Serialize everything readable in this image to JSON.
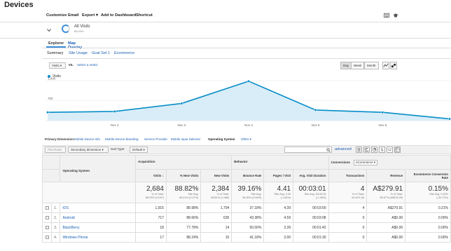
{
  "header": {
    "title": "Devices"
  },
  "toolbar": {
    "customize": "Customize",
    "email": "Email",
    "export": "Export ▾",
    "add_to_dashboard": "Add to Dashboard",
    "shortcut": "Shortcut"
  },
  "segment": {
    "label": "All Visits",
    "sub": "88.09%"
  },
  "views": {
    "explorer": "Explorer",
    "map_overlay": "Map Overlay"
  },
  "subnav": {
    "summary": "Summary",
    "site_usage": "Site Usage",
    "goal_set": "Goal Set 1",
    "ecommerce": "Ecommerce"
  },
  "chart_controls": {
    "metric": "Visits ▾",
    "vs": "vs.",
    "select_metric": "Select a metric",
    "day": "Day",
    "week": "Week",
    "month": "Month"
  },
  "chart_data": {
    "type": "line",
    "x": [
      "Nov 1",
      "Nov 2",
      "Nov 3",
      "Nov 4",
      "Nov 5",
      "Nov 6",
      "Nov 7"
    ],
    "series": [
      {
        "name": "Visits",
        "values": [
          290,
          320,
          600,
          1380,
          370,
          290,
          60
        ]
      }
    ],
    "ylim": [
      0,
      1400
    ],
    "yticks": [
      {
        "value": 1400,
        "label": "1,400"
      },
      {
        "value": 700,
        "label": "700"
      }
    ],
    "xticks": [
      {
        "value": "Nov 2",
        "label": "Nov 2"
      },
      {
        "value": "Nov 3",
        "label": "Nov 3"
      },
      {
        "value": "Nov 4",
        "label": "Nov 4"
      },
      {
        "value": "Nov 5",
        "label": "Nov 5"
      },
      {
        "value": "Nov 6",
        "label": "Nov 6"
      }
    ],
    "legend": "top-left",
    "color": "#058dc7",
    "fill": "#d9edf8"
  },
  "dimensions": {
    "label": "Primary Dimension:",
    "items": [
      "Mobile Device Info",
      "Mobile Device Branding",
      "Service Provider",
      "Mobile Input Selector",
      "Operating System",
      "Other ▾"
    ]
  },
  "controls": {
    "plot_rows": "Plot Rows",
    "secondary": "Secondary dimension ▾",
    "sort_label": "Sort Type:",
    "sort_value": "Default ▾",
    "advanced": "advanced"
  },
  "table": {
    "groups": {
      "acquisition": "Acquisition",
      "behavior": "Behavior",
      "conversions": "Conversions",
      "conversion_select": "eCommerce ▾"
    },
    "dim_header": "Operating System",
    "headers": [
      "Visits",
      "% New Visits",
      "New Visits",
      "Bounce Rate",
      "Pages / Visit",
      "Avg. Visit Duration",
      "Transactions",
      "Revenue",
      "Ecommerce Conversion Rate"
    ],
    "totals": [
      {
        "value": "2,684",
        "sub1": "% of Total:",
        "sub2": "88.09% (3,047)"
      },
      {
        "value": "88.82%",
        "sub1": "Site Avg:",
        "sub2": "88.41% (0.47%)"
      },
      {
        "value": "2,384",
        "sub1": "% of Total:",
        "sub2": "88.61% (2,485)"
      },
      {
        "value": "39.16%",
        "sub1": "Site Avg:",
        "sub2": "38.90% (0.69%)"
      },
      {
        "value": "4.41",
        "sub1": "Site Avg: 4.49",
        "sub2": "(-1.86%)"
      },
      {
        "value": "00:03:01",
        "sub1": "Site Avg: 00:03:04",
        "sub2": "(-1.45%)"
      },
      {
        "value": "4",
        "sub1": "% of Total:",
        "sub2": "44.44% (9)"
      },
      {
        "value": "A$279.91",
        "sub1": "% of Total:",
        "sub2": "65.67% (A$426.25)"
      },
      {
        "value": "0.15%",
        "sub1": "Site Avg: 0.30%",
        "sub2": "(-34.72%)"
      }
    ],
    "rows": [
      {
        "idx": "1.",
        "name": "iOS",
        "cells": [
          "1,915",
          "88.98%",
          "1,704",
          "37.18%",
          "4.39",
          "00:03:00",
          "4",
          "A$279.91",
          "0.21%"
        ]
      },
      {
        "idx": "2.",
        "name": "Android",
        "cells": [
          "717",
          "88.66%",
          "635",
          "43.38%",
          "4.59",
          "00:03:08",
          "0",
          "A$0.00",
          "0.00%"
        ]
      },
      {
        "idx": "3.",
        "name": "BlackBerry",
        "cells": [
          "18",
          "77.78%",
          "14",
          "50.00%",
          "3.39",
          "00:01:42",
          "0",
          "A$0.00",
          "0.00%"
        ]
      },
      {
        "idx": "4.",
        "name": "Windows Phone",
        "cells": [
          "17",
          "88.24%",
          "15",
          "41.18%",
          "3.00",
          "00:01:30",
          "0",
          "A$0.00",
          "0.00%"
        ]
      }
    ]
  }
}
